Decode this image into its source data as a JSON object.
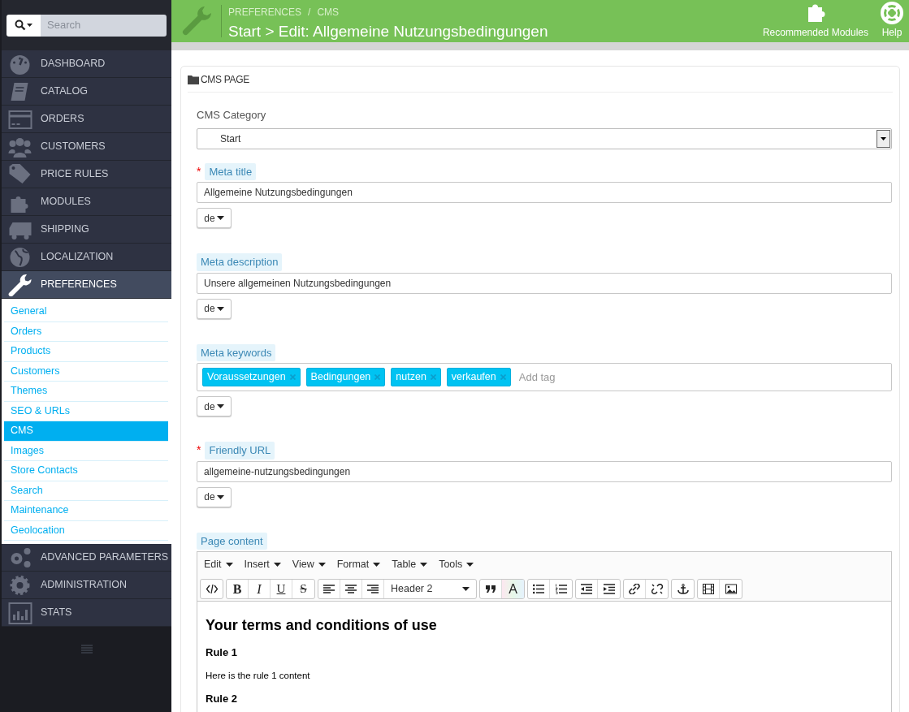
{
  "search": {
    "placeholder": "Search"
  },
  "nav": [
    {
      "label": "DASHBOARD",
      "selected": false
    },
    {
      "label": "CATALOG",
      "selected": false
    },
    {
      "label": "ORDERS",
      "selected": false
    },
    {
      "label": "CUSTOMERS",
      "selected": false
    },
    {
      "label": "PRICE RULES",
      "selected": false
    },
    {
      "label": "MODULES",
      "selected": false
    },
    {
      "label": "SHIPPING",
      "selected": false
    },
    {
      "label": "LOCALIZATION",
      "selected": false
    },
    {
      "label": "PREFERENCES",
      "selected": true,
      "children": [
        {
          "label": "General",
          "selected": false
        },
        {
          "label": "Orders",
          "selected": false
        },
        {
          "label": "Products",
          "selected": false
        },
        {
          "label": "Customers",
          "selected": false
        },
        {
          "label": "Themes",
          "selected": false
        },
        {
          "label": "SEO & URLs",
          "selected": false
        },
        {
          "label": "CMS",
          "selected": true
        },
        {
          "label": "Images",
          "selected": false
        },
        {
          "label": "Store Contacts",
          "selected": false
        },
        {
          "label": "Search",
          "selected": false
        },
        {
          "label": "Maintenance",
          "selected": false
        },
        {
          "label": "Geolocation",
          "selected": false
        }
      ]
    },
    {
      "label": "ADVANCED PARAMETERS",
      "selected": false
    },
    {
      "label": "ADMINISTRATION",
      "selected": false
    },
    {
      "label": "STATS",
      "selected": false
    }
  ],
  "header": {
    "breadcrumb": [
      "PREFERENCES",
      "CMS"
    ],
    "breadcrumb_separator": "/",
    "title": "Start > Edit: Allgemeine Nutzungsbedingungen",
    "actions": [
      {
        "label": "Recommended Modules"
      },
      {
        "label": "Help"
      }
    ]
  },
  "panel": {
    "title": "CMS PAGE",
    "fields": [
      {
        "kind": "select",
        "label": "CMS Category",
        "value": "Start"
      },
      {
        "kind": "text",
        "label": "Meta title",
        "required_mark": "*",
        "value": "Allgemeine Nutzungsbedingungen",
        "language": "de"
      },
      {
        "kind": "text",
        "label": "Meta description",
        "value": "Unsere allgemeinen Nutzungsbedingungen",
        "language": "de"
      },
      {
        "kind": "tags",
        "label": "Meta keywords",
        "tags": [
          "Voraussetzungen",
          "Bedingungen",
          "nutzen",
          "verkaufen"
        ],
        "placeholder": "Add tag",
        "language": "de"
      },
      {
        "kind": "text",
        "label": "Friendly URL",
        "required_mark": "*",
        "value": "allgemeine-nutzungsbedingungen",
        "language": "de"
      },
      {
        "kind": "editor",
        "label": "Page content"
      }
    ],
    "editor": {
      "menus": [
        "Edit",
        "Insert",
        "View",
        "Format",
        "Table",
        "Tools"
      ],
      "style_buttons": [
        "B",
        "I",
        "U",
        "S"
      ],
      "format": "Header 2",
      "text_color_button": "A",
      "content": [
        {
          "kind": "h2",
          "text": "Your terms and conditions of use"
        },
        {
          "kind": "h3",
          "text": "Rule 1"
        },
        {
          "kind": "p",
          "text": "Here is the rule 1 content"
        },
        {
          "kind": "h3",
          "text": "Rule 2"
        }
      ]
    }
  }
}
